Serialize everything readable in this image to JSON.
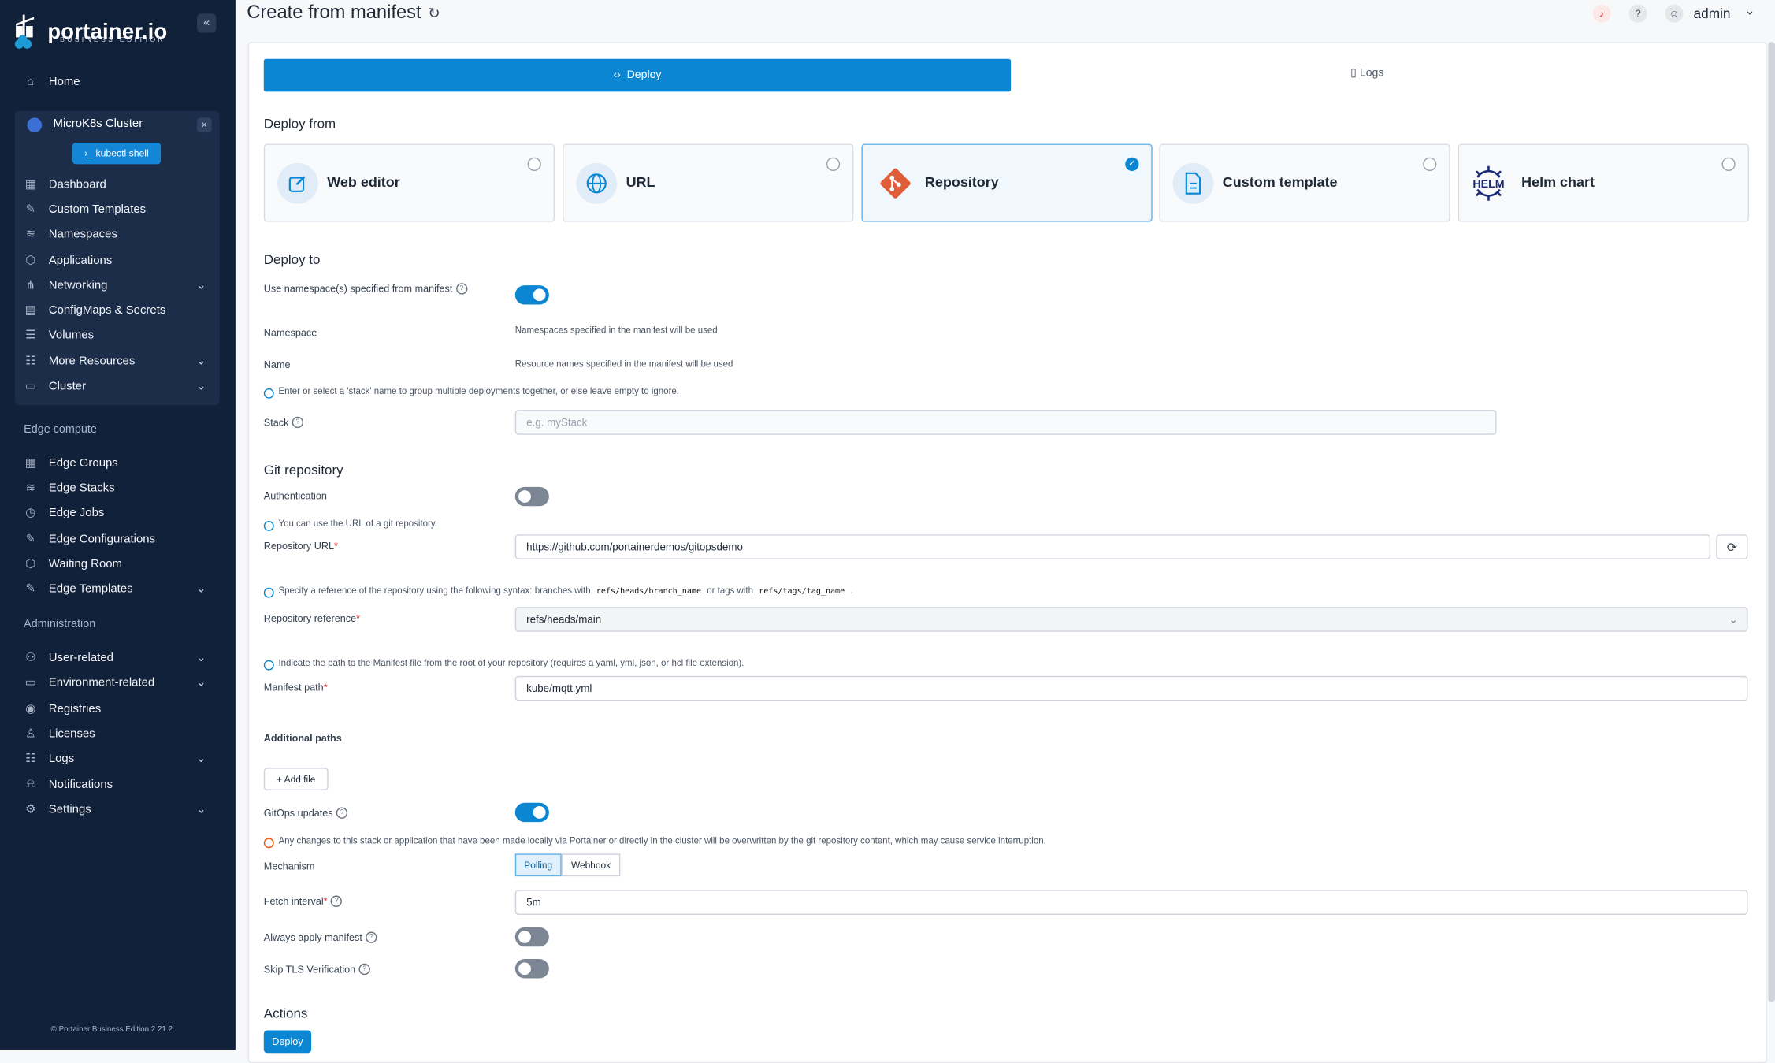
{
  "brand": {
    "name": "portainer.io",
    "edition": "BUSINESS EDITION"
  },
  "sidebar": {
    "home": "Home",
    "environment": {
      "name": "MicroK8s Cluster",
      "kubectl_label": "kubectl shell"
    },
    "env_items": [
      {
        "label": "Dashboard"
      },
      {
        "label": "Custom Templates"
      },
      {
        "label": "Namespaces"
      },
      {
        "label": "Applications"
      },
      {
        "label": "Networking"
      },
      {
        "label": "ConfigMaps & Secrets"
      },
      {
        "label": "Volumes"
      },
      {
        "label": "More Resources"
      },
      {
        "label": "Cluster"
      }
    ],
    "edge_title": "Edge compute",
    "edge_items": [
      {
        "label": "Edge Groups"
      },
      {
        "label": "Edge Stacks"
      },
      {
        "label": "Edge Jobs"
      },
      {
        "label": "Edge Configurations"
      },
      {
        "label": "Waiting Room"
      },
      {
        "label": "Edge Templates"
      }
    ],
    "admin_title": "Administration",
    "admin_items": [
      {
        "label": "User-related"
      },
      {
        "label": "Environment-related"
      },
      {
        "label": "Registries"
      },
      {
        "label": "Licenses"
      },
      {
        "label": "Logs"
      },
      {
        "label": "Notifications"
      },
      {
        "label": "Settings"
      }
    ],
    "footer": "© Portainer Business Edition 2.21.2"
  },
  "header": {
    "title": "Create from manifest",
    "user": "admin"
  },
  "tabs": {
    "deploy": "Deploy",
    "logs": "Logs"
  },
  "deploy_from": {
    "title": "Deploy from",
    "options": [
      {
        "label": "Web editor",
        "selected": false
      },
      {
        "label": "URL",
        "selected": false
      },
      {
        "label": "Repository",
        "selected": true
      },
      {
        "label": "Custom template",
        "selected": false
      },
      {
        "label": "Helm chart",
        "selected": false
      }
    ],
    "helm_logo_text": "HELM"
  },
  "deploy_to": {
    "title": "Deploy to",
    "use_ns_label": "Use namespace(s) specified from manifest",
    "use_ns_on": true,
    "namespace_label": "Namespace",
    "namespace_text": "Namespaces specified in the manifest will be used",
    "name_label": "Name",
    "name_text": "Resource names specified in the manifest will be used",
    "stack_help": "Enter or select a 'stack' name to group multiple deployments together, or else leave empty to ignore.",
    "stack_label": "Stack",
    "stack_placeholder": "e.g. myStack"
  },
  "git": {
    "title": "Git repository",
    "auth_label": "Authentication",
    "auth_on": false,
    "url_help": "You can use the URL of a git repository.",
    "url_label": "Repository URL",
    "url_value": "https://github.com/portainerdemos/gitopsdemo",
    "ref_help_1": "Specify a reference of the repository using the following syntax: branches with",
    "ref_code_1": "refs/heads/branch_name",
    "ref_help_2": "or tags with",
    "ref_code_2": "refs/tags/tag_name",
    "ref_help_3": ".",
    "ref_label": "Repository reference",
    "ref_value": "refs/heads/main",
    "path_help": "Indicate the path to the Manifest file from the root of your repository (requires a yaml, yml, json, or hcl file extension).",
    "path_label": "Manifest path",
    "path_value": "kube/mqtt.yml",
    "additional_title": "Additional paths",
    "add_file": "+ Add file",
    "gitops_label": "GitOps updates",
    "gitops_on": true,
    "gitops_warn": "Any changes to this stack or application that have been made locally via Portainer or directly in the cluster will be overwritten by the git repository content, which may cause service interruption.",
    "mechanism_label": "Mechanism",
    "mechanism_options": [
      "Polling",
      "Webhook"
    ],
    "mechanism_selected": "Polling",
    "fetch_label": "Fetch interval",
    "fetch_value": "5m",
    "always_apply_label": "Always apply manifest",
    "always_apply_on": false,
    "skip_tls_label": "Skip TLS Verification",
    "skip_tls_on": false
  },
  "actions": {
    "title": "Actions",
    "deploy": "Deploy"
  },
  "colors": {
    "sidebar": "#11213a",
    "accent": "#0a86d2",
    "page": "#f7f8fa"
  }
}
